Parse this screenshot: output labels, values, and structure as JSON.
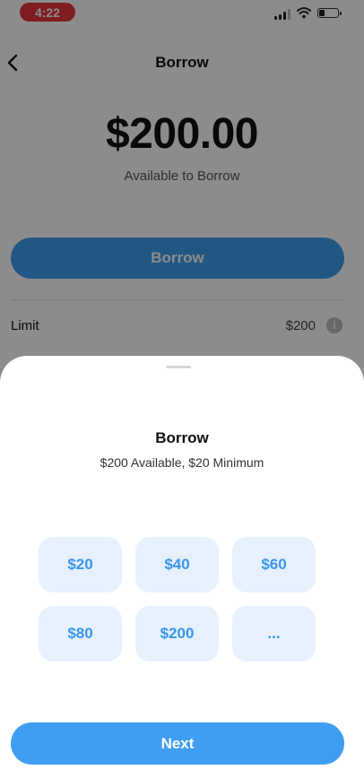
{
  "status_bar": {
    "time": "4:22"
  },
  "header": {
    "title": "Borrow"
  },
  "summary": {
    "amount": "$200.00",
    "subtitle": "Available to Borrow",
    "borrow_button": "Borrow"
  },
  "limit": {
    "label": "Limit",
    "value": "$200",
    "info_glyph": "i"
  },
  "sheet": {
    "title": "Borrow",
    "subtitle": "$200 Available, $20 Minimum",
    "options": [
      "$20",
      "$40",
      "$60",
      "$80",
      "$200",
      "..."
    ],
    "next_button": "Next"
  },
  "colors": {
    "accent": "#3f9ef1",
    "chip_bg": "#e7f1fd",
    "time_pill": "#e8333a"
  }
}
